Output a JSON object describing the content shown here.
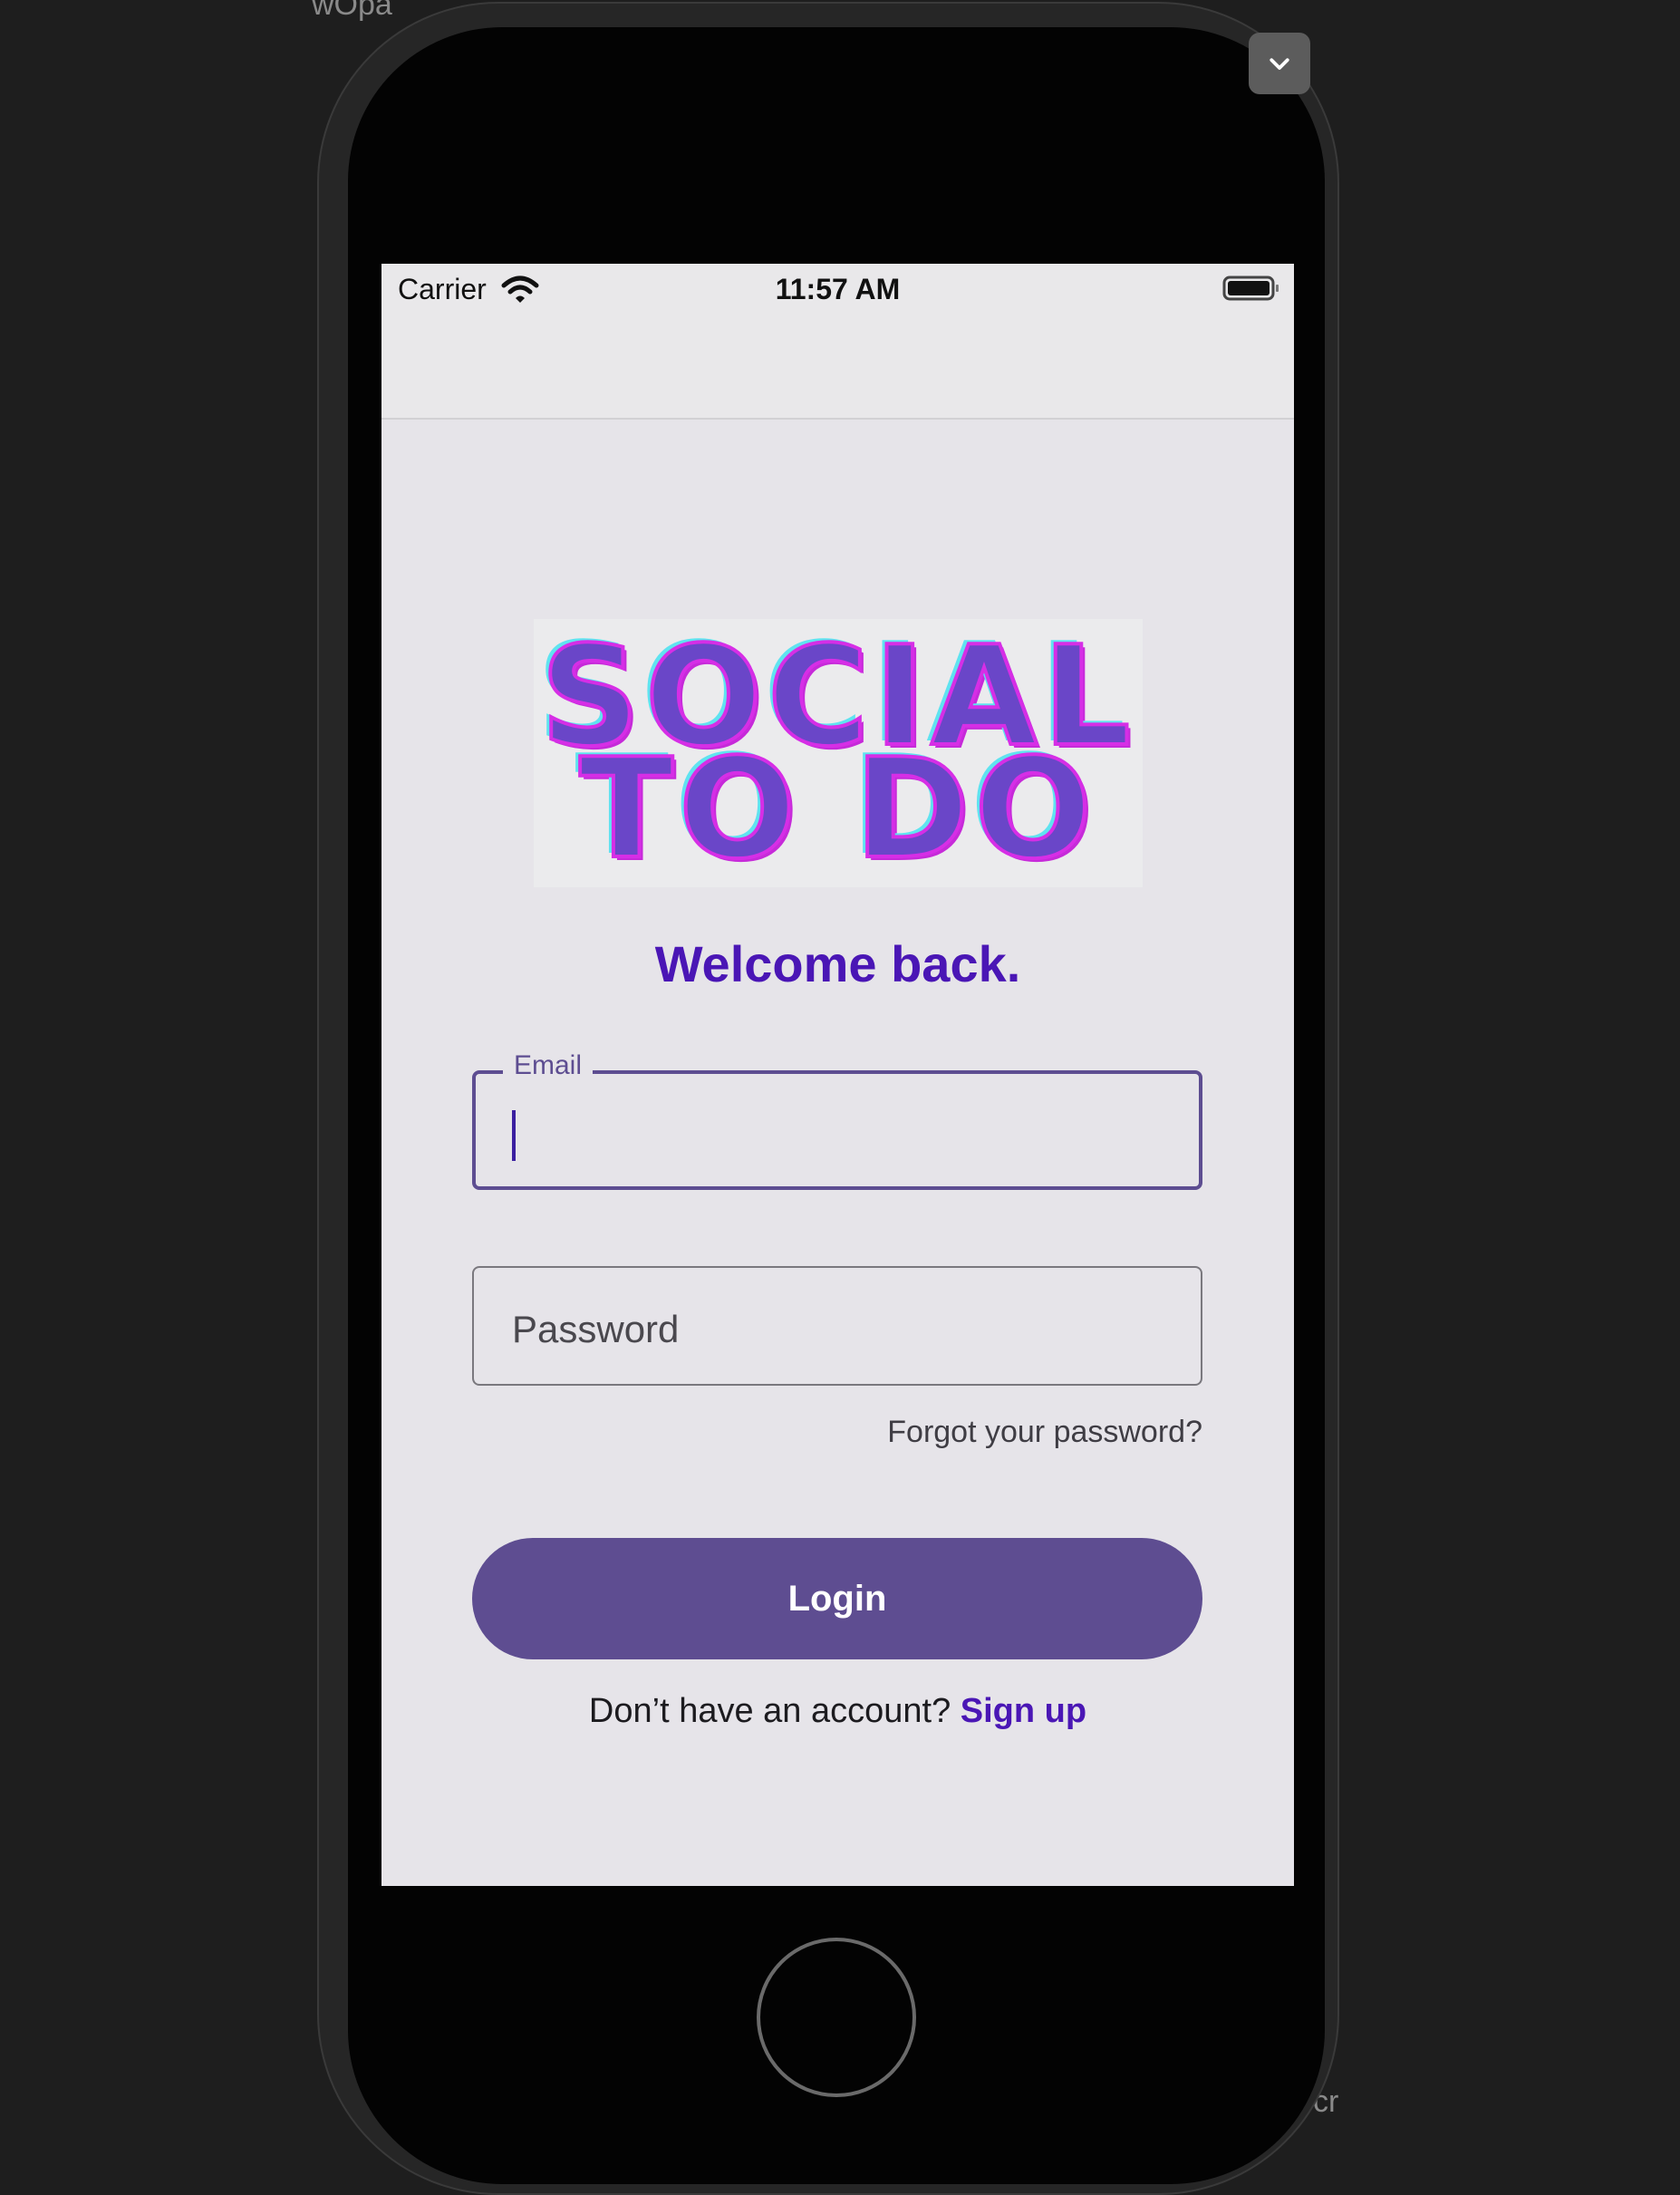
{
  "background": {
    "fragment_top": "wOpa",
    "fragment_bottom_right": "cr"
  },
  "simulator": {
    "collapse_icon": "chevron-down-icon"
  },
  "status_bar": {
    "carrier": "Carrier",
    "time": "11:57 AM",
    "wifi_icon": "wifi-icon",
    "battery_icon": "battery-icon"
  },
  "logo": {
    "line1": "SOCIAL",
    "line2": "TO DO",
    "colors": {
      "fill": "#6a46c8",
      "outline": "#d62ee6",
      "shadow": "#5fe3f0"
    }
  },
  "welcome": "Welcome back.",
  "email_field": {
    "label": "Email",
    "value": ""
  },
  "password_field": {
    "placeholder": "Password",
    "value": ""
  },
  "forgot_password": "Forgot your password?",
  "login_button": "Login",
  "signup": {
    "prompt": "Don’t have an account?",
    "link": "Sign up"
  },
  "colors": {
    "accent": "#5e4d91",
    "link": "#4a16b5",
    "screen_bg": "#e6e4e9"
  }
}
